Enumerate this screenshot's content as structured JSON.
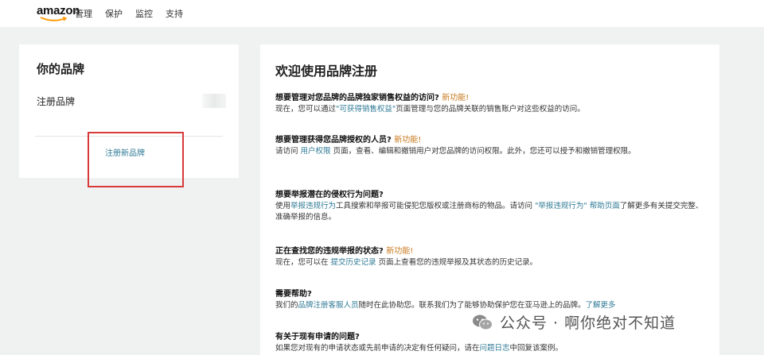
{
  "header": {
    "logo_text": "amazon",
    "nav": [
      "管理",
      "保护",
      "监控",
      "支持"
    ]
  },
  "left_card": {
    "title": "你的品牌",
    "registered_label": "注册品牌",
    "new_brand_link": "注册新品牌"
  },
  "right_card": {
    "title": "欢迎使用品牌注册",
    "sections": [
      {
        "q": "想要管理对您品牌的品牌独家销售权益的访问?",
        "new_tag": "新功能!",
        "d1": "现在，您可以通过",
        "link1": "\"可获得销售权益\"",
        "d2": "页面管理与您的品牌关联的销售账户对这些权益的访问。"
      },
      {
        "q": "想要管理获得您品牌授权的人员?",
        "new_tag": "新功能!",
        "d1": "请访问 ",
        "link1": "用户权限",
        "d2": " 页面，查看、编辑和撤销用户对您品牌的访问权限。此外，您还可以授予和撤销管理权限。"
      },
      {
        "q": "想要举报潜在的侵权行为问题?",
        "d1": "使用",
        "link1": "举报违规行为",
        "d2": "工具搜索和举报可能侵犯您版权或注册商标的物品。请访问 ",
        "link2": "\"举报违规行为\" 帮助页面",
        "d3": "了解更多有关提交完整、准确举报的信息。"
      },
      {
        "q": "正在查找您的违规举报的状态?",
        "new_tag": "新功能!",
        "d1": "现在，您可以在 ",
        "link1": "提交历史记录",
        "d2": " 页面上查看您的违规举报及其状态的历史记录。"
      },
      {
        "q": "需要帮助?",
        "d1": "我们的",
        "link1": "品牌注册客服人员",
        "d2": "随时在此协助您。联系我们为了能够协助保护您在亚马逊上的品牌。",
        "link2": "了解更多"
      },
      {
        "q": "有关于现有申请的问题?",
        "d1": "如果您对现有的申请状态或先前申请的决定有任何疑问，请在",
        "link1": "问题日志",
        "d2": "中回复该案例。"
      }
    ]
  },
  "watermark": {
    "text": "公众号 · 啊你绝对不知道",
    "icon": "wechat-icon"
  },
  "colors": {
    "link": "#2f7a95",
    "new_tag": "#c8791c",
    "highlight": "#d83a3a"
  }
}
